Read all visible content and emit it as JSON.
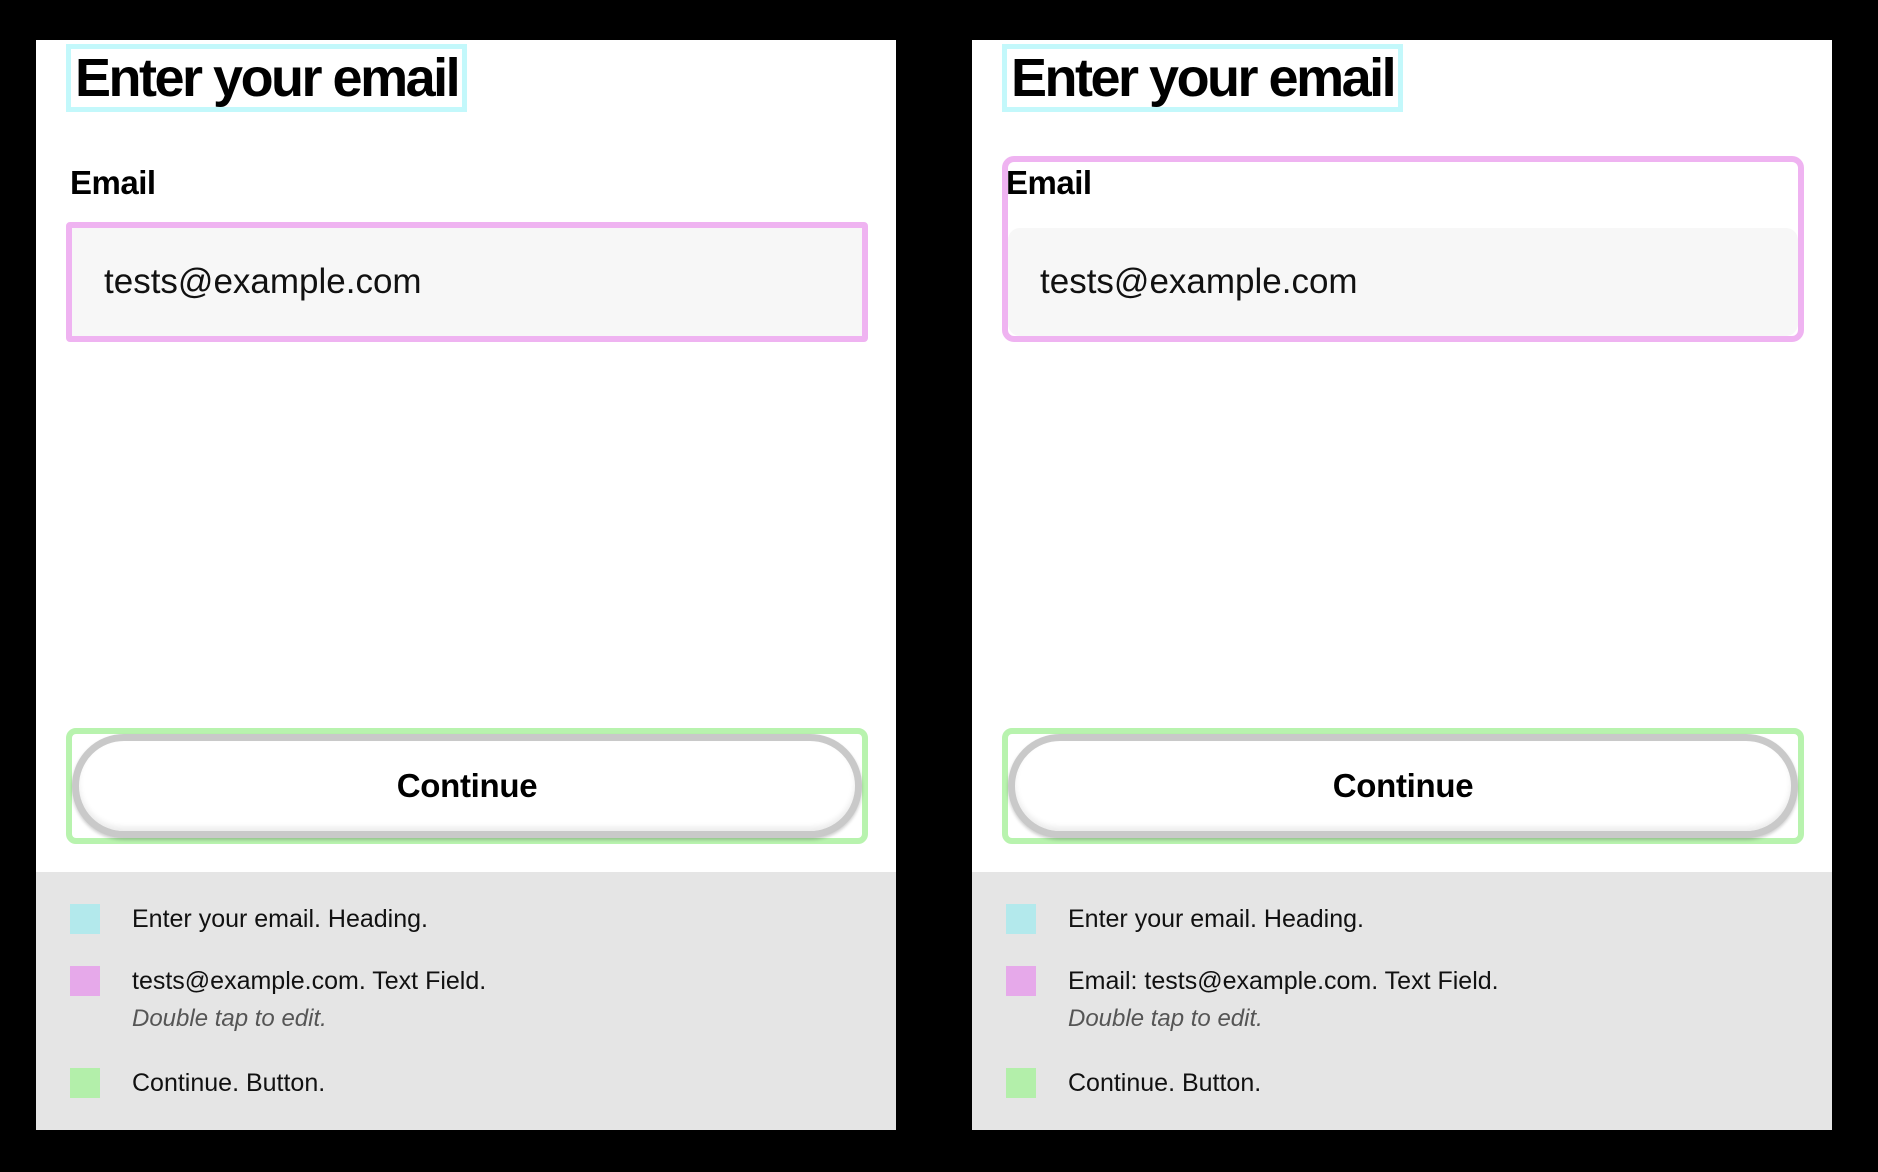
{
  "colors": {
    "heading_highlight": "#c3f8fb",
    "field_highlight": "#efb3f1",
    "button_highlight": "#b8f3ae",
    "swatch_heading": "#b3e9ec",
    "swatch_field": "#e6a9ea",
    "swatch_button": "#b3efaa",
    "input_background": "#f7f7f7",
    "legend_background": "#e5e5e5"
  },
  "panels": [
    {
      "heading": "Enter your email",
      "email_label": "Email",
      "email_value": "tests@example.com",
      "button_label": "Continue",
      "legend": [
        {
          "text": "Enter your email. Heading.",
          "hint": ""
        },
        {
          "text": "tests@example.com. Text Field.",
          "hint": "Double tap to edit."
        },
        {
          "text": "Continue. Button.",
          "hint": ""
        }
      ]
    },
    {
      "heading": "Enter your email",
      "email_label": "Email",
      "email_value": "tests@example.com",
      "button_label": "Continue",
      "legend": [
        {
          "text": "Enter your email. Heading.",
          "hint": ""
        },
        {
          "text": "Email: tests@example.com. Text Field.",
          "hint": "Double tap to edit."
        },
        {
          "text": "Continue. Button.",
          "hint": ""
        }
      ]
    }
  ]
}
